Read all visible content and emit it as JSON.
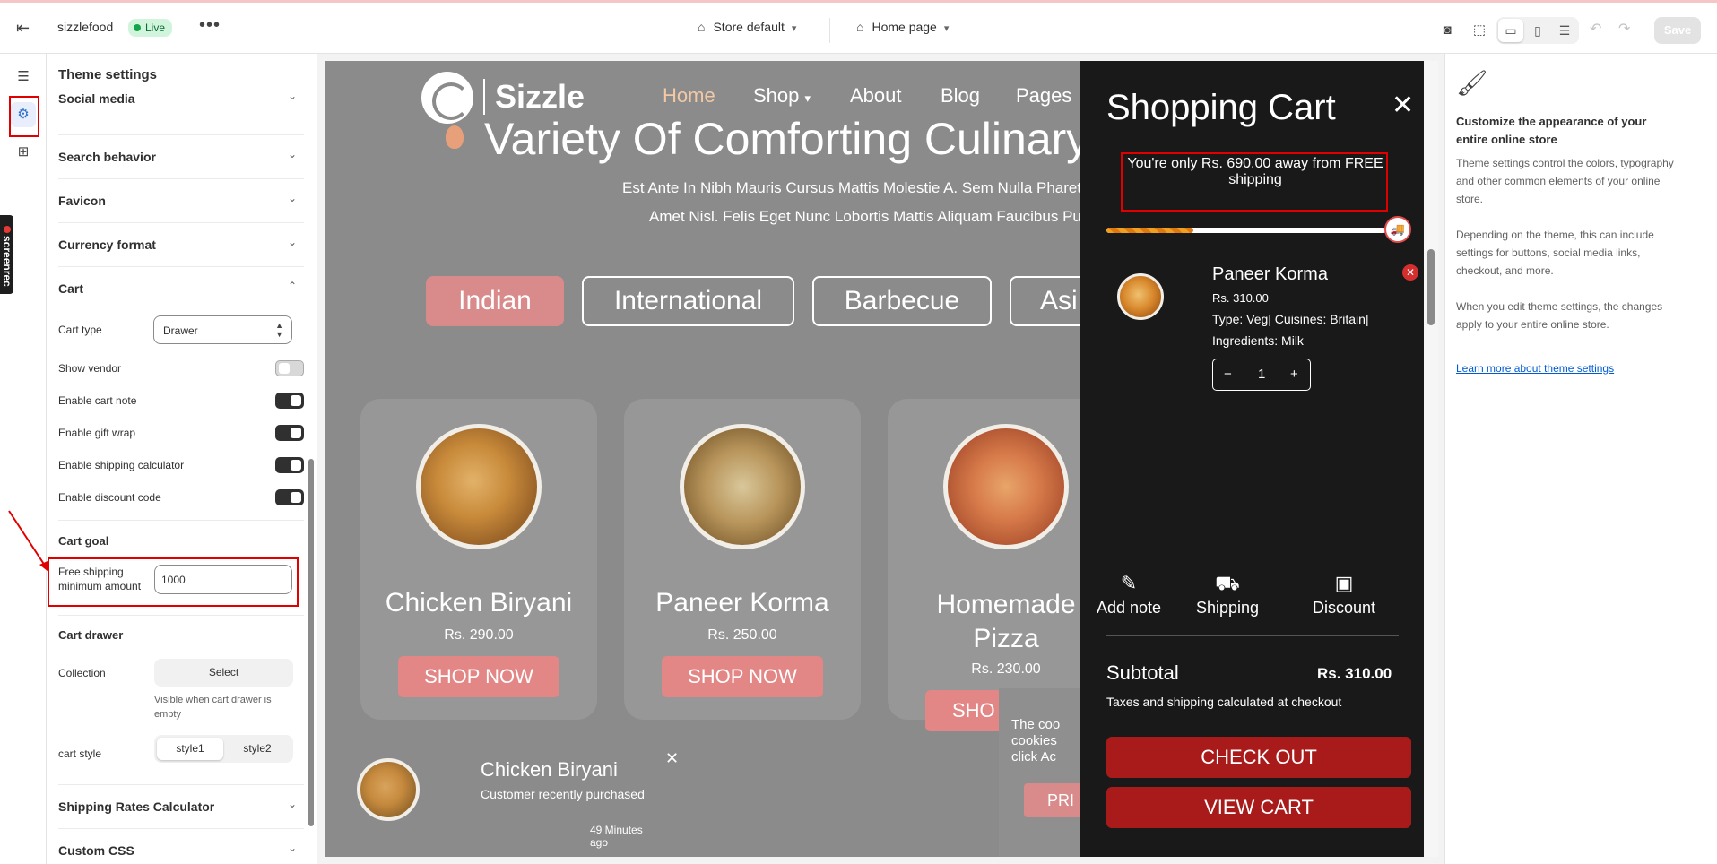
{
  "topbar": {
    "store_name": "sizzlefood",
    "live_label": "Live",
    "more": "•••",
    "theme_selector": "Store default",
    "page_selector": "Home page",
    "save_label": "Save"
  },
  "screenrec_label": "screenrec",
  "settings": {
    "title": "Theme settings",
    "sections_top": [
      "Social media",
      "Search behavior",
      "Favicon",
      "Currency format",
      "Cart"
    ],
    "cart": {
      "cart_type_label": "Cart type",
      "cart_type_value": "Drawer",
      "toggles": [
        {
          "label": "Show vendor",
          "on": false
        },
        {
          "label": "Enable cart note",
          "on": true
        },
        {
          "label": "Enable gift wrap",
          "on": true
        },
        {
          "label": "Enable shipping calculator",
          "on": true
        },
        {
          "label": "Enable discount code",
          "on": true
        }
      ],
      "goal_heading": "Cart goal",
      "free_shipping_label": "Free shipping minimum amount",
      "free_shipping_value": "1000",
      "drawer_heading": "Cart drawer",
      "collection_label": "Collection",
      "select_button": "Select",
      "collection_hint": "Visible when cart drawer is empty",
      "style_label": "cart style",
      "style_options": [
        "style1",
        "style2"
      ]
    },
    "sections_bottom": [
      "Shipping Rates Calculator",
      "Custom CSS"
    ]
  },
  "preview": {
    "logo_text": "Sizzle",
    "nav": [
      "Home",
      "Shop",
      "About",
      "Blog",
      "Pages"
    ],
    "hero_title": "Variety Of Comforting Culinary",
    "hero_sub_1": "Est Ante In Nibh Mauris Cursus Mattis Molestie A. Sem Nulla Pharetra D",
    "hero_sub_2": "Amet Nisl. Felis Eget Nunc Lobortis Mattis Aliquam Faucibus Purus",
    "categories": [
      "Indian",
      "International",
      "Barbecue",
      "Asi"
    ],
    "products": [
      {
        "name": "Chicken Biryani",
        "price": "Rs. 290.00",
        "cta": "SHOP NOW"
      },
      {
        "name": "Paneer Korma",
        "price": "Rs. 250.00",
        "cta": "SHOP NOW"
      },
      {
        "name": "Homemade Pizza",
        "price": "Rs. 230.00",
        "cta": "SHO"
      }
    ],
    "toast": {
      "name": "Chicken Biryani",
      "caption": "Customer recently purchased",
      "time": "49 Minutes ago",
      "close": "✕"
    },
    "cookie": {
      "lines": [
        "The coo",
        "cookies",
        "click Ac"
      ],
      "button": "PRI"
    }
  },
  "cart": {
    "title": "Shopping Cart",
    "close": "✕",
    "free_shipping_message": "You're only Rs. 690.00 away from FREE shipping",
    "progress": 0.31,
    "item": {
      "name": "Paneer Korma",
      "price": "Rs. 310.00",
      "meta_1": "Type: Veg|  Cuisines: Britain|",
      "meta_2": "Ingredients: Milk",
      "qty": "1",
      "minus": "−",
      "plus": "+",
      "remove": "✕"
    },
    "actions": [
      "Add note",
      "Shipping",
      "Discount"
    ],
    "subtotal_label": "Subtotal",
    "subtotal_value": "Rs. 310.00",
    "tax_note": "Taxes and shipping calculated at checkout",
    "checkout": "CHECK OUT",
    "view_cart": "VIEW CART"
  },
  "right": {
    "heading": "Customize the appearance of your entire online store",
    "p1": "Theme settings control the colors, typography and other common elements of your online store.",
    "p2": "Depending on the theme, this can include settings for buttons, social media links, checkout, and more.",
    "p3": "When you edit theme settings, the changes apply to your entire online store.",
    "link": "Learn more about theme settings"
  },
  "colors": {
    "accent_red": "#e00000",
    "live_green": "#13a34a",
    "cart_button": "#a91b1b",
    "category_active": "#d98a8a"
  }
}
